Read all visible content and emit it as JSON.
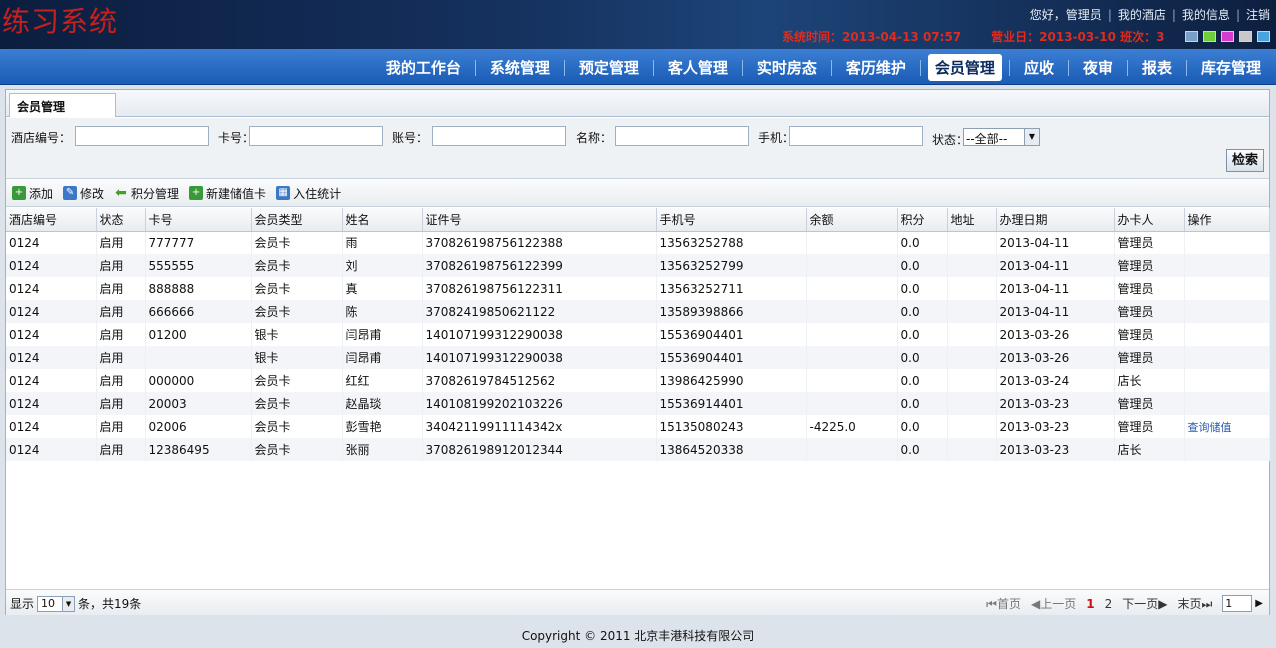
{
  "app_title": "练习系统",
  "user_links": [
    "您好，管理员",
    "我的酒店",
    "我的信息",
    "注销"
  ],
  "status": {
    "system_time_label": "系统时间：",
    "system_time": "2013-04-13 07:57",
    "biz_day_label": "营业日：",
    "biz_day": "2013-03-10",
    "shift_label": "班次：",
    "shift": "3"
  },
  "theme_swatches": [
    "#7a9fc8",
    "#6fcf3a",
    "#d53bd0",
    "#c8c8c8",
    "#4aa3dc"
  ],
  "nav": [
    "我的工作台",
    "系统管理",
    "预定管理",
    "客人管理",
    "实时房态",
    "客历维护",
    "会员管理",
    "应收",
    "夜审",
    "报表",
    "库存管理"
  ],
  "nav_active": 6,
  "tab_label": "会员管理",
  "search": {
    "hotel_no": "酒店编号：",
    "card_no": "卡号：",
    "account": "账号：",
    "name": "名称：",
    "phone": "手机：",
    "status": "状态：",
    "status_value": "--全部--",
    "button": "检索"
  },
  "toolbar": [
    "添加",
    "修改",
    "积分管理",
    "新建储值卡",
    "入住统计"
  ],
  "columns": [
    "酒店编号",
    "状态",
    "卡号",
    "会员类型",
    "姓名",
    "证件号",
    "手机号",
    "余额",
    "积分",
    "地址",
    "办理日期",
    "办卡人",
    "操作"
  ],
  "rows": [
    [
      "0124",
      "启用",
      "777777",
      "会员卡",
      "雨",
      "370826198756122388",
      "13563252788",
      "",
      "0.0",
      "",
      "2013-04-11",
      "管理员",
      ""
    ],
    [
      "0124",
      "启用",
      "555555",
      "会员卡",
      "刘",
      "370826198756122399",
      "13563252799",
      "",
      "0.0",
      "",
      "2013-04-11",
      "管理员",
      ""
    ],
    [
      "0124",
      "启用",
      "888888",
      "会员卡",
      "真",
      "370826198756122311",
      "13563252711",
      "",
      "0.0",
      "",
      "2013-04-11",
      "管理员",
      ""
    ],
    [
      "0124",
      "启用",
      "666666",
      "会员卡",
      "陈",
      "37082419850621122",
      "13589398866",
      "",
      "0.0",
      "",
      "2013-04-11",
      "管理员",
      ""
    ],
    [
      "0124",
      "启用",
      "01200",
      "银卡",
      "闫昂甫",
      "140107199312290038",
      "15536904401",
      "",
      "0.0",
      "",
      "2013-03-26",
      "管理员",
      ""
    ],
    [
      "0124",
      "启用",
      "",
      "银卡",
      "闫昂甫",
      "140107199312290038",
      "15536904401",
      "",
      "0.0",
      "",
      "2013-03-26",
      "管理员",
      ""
    ],
    [
      "0124",
      "启用",
      "000000",
      "会员卡",
      "红红",
      "37082619784512562",
      "13986425990",
      "",
      "0.0",
      "",
      "2013-03-24",
      "店长",
      ""
    ],
    [
      "0124",
      "启用",
      "20003",
      "会员卡",
      "赵晶琰",
      "140108199202103226",
      "15536914401",
      "",
      "0.0",
      "",
      "2013-03-23",
      "管理员",
      ""
    ],
    [
      "0124",
      "启用",
      "02006",
      "会员卡",
      "彭雪艳",
      "34042119911114342x",
      "15135080243",
      "-4225.0",
      "0.0",
      "",
      "2013-03-23",
      "管理员",
      "查询储值"
    ],
    [
      "0124",
      "启用",
      "12386495",
      "会员卡",
      "张丽",
      "370826198912012344",
      "13864520338",
      "",
      "0.0",
      "",
      "2013-03-23",
      "店长",
      ""
    ]
  ],
  "pager": {
    "show": "显示",
    "size": "10",
    "total": "条，共19条",
    "first": "首页",
    "prev": "上一页",
    "pages": [
      "1",
      "2"
    ],
    "current": "1",
    "next": "下一页",
    "last": "末页",
    "goto": "1"
  },
  "footer": "Copyright © 2011 北京丰港科技有限公司"
}
